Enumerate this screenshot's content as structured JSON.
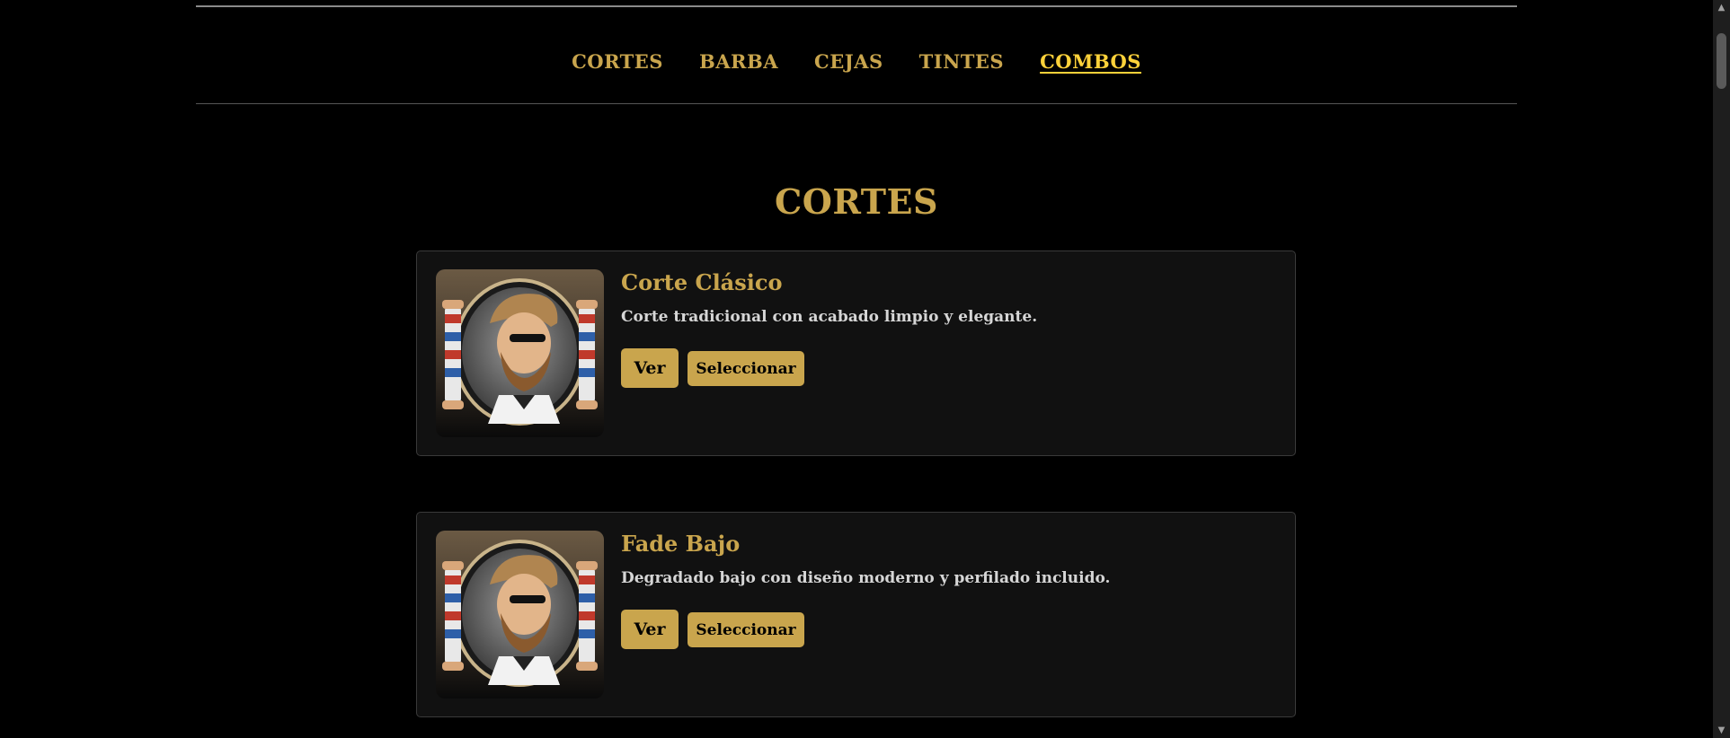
{
  "nav": {
    "items": [
      {
        "label": "CORTES",
        "active": false
      },
      {
        "label": "BARBA",
        "active": false
      },
      {
        "label": "CEJAS",
        "active": false
      },
      {
        "label": "TINTES",
        "active": false
      },
      {
        "label": "COMBOS",
        "active": true
      }
    ]
  },
  "section": {
    "title": "CORTES"
  },
  "services": [
    {
      "title": "Corte Clásico",
      "description": "Corte tradicional con acabado limpio y elegante.",
      "view_label": "Ver",
      "select_label": "Seleccionar",
      "image_icon": "barber-logo-icon"
    },
    {
      "title": "Fade Bajo",
      "description": "Degradado bajo con diseño moderno y perfilado incluido.",
      "view_label": "Ver",
      "select_label": "Seleccionar",
      "image_icon": "barber-logo-icon"
    }
  ],
  "colors": {
    "background": "#000000",
    "gold": "#c9a54d",
    "active_nav": "#ffd23a",
    "card_bg": "#111111"
  },
  "scrollbar": {
    "up_icon": "arrow-up-icon",
    "down_icon": "arrow-down-icon"
  }
}
